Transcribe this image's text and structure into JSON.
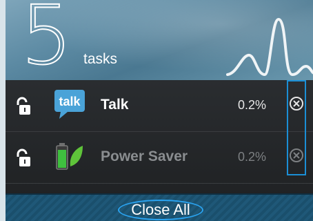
{
  "header": {
    "task_count": "5",
    "tasks_label": "tasks"
  },
  "tasks": [
    {
      "name": "Talk",
      "usage": "0.2%",
      "icon": "talk-app-icon",
      "lock": "unlocked-padlock-icon",
      "active": true
    },
    {
      "name": "Power Saver",
      "usage": "0.2%",
      "icon": "battery-leaf-icon",
      "lock": "unlocked-padlock-icon",
      "active": false
    }
  ],
  "footer": {
    "close_all_label": "Close All"
  },
  "colors": {
    "accent": "#1b8fd6",
    "header": "#5c8aa3",
    "list_bg": "#25282b"
  }
}
